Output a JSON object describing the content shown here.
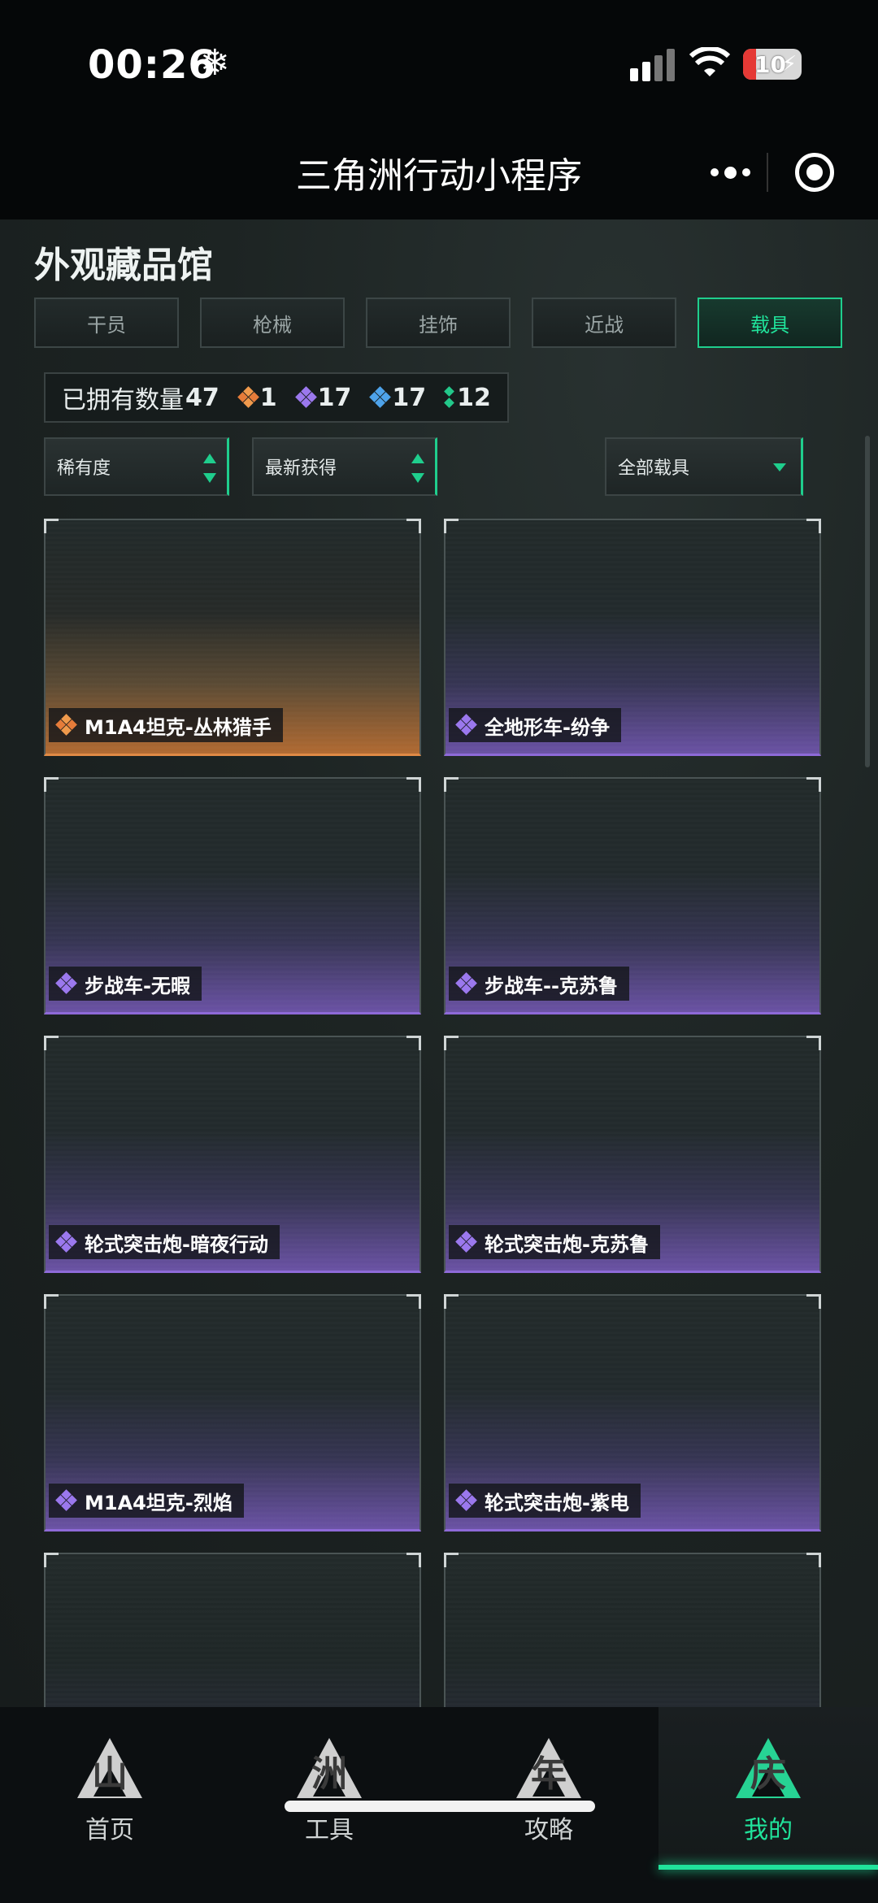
{
  "status_bar": {
    "time": "00:26",
    "battery": "10"
  },
  "title_bar": {
    "title": "三角洲行动小程序"
  },
  "page": {
    "title": "外观藏品馆",
    "tabs": [
      {
        "label": "干员",
        "active": false
      },
      {
        "label": "枪械",
        "active": false
      },
      {
        "label": "挂饰",
        "active": false
      },
      {
        "label": "近战",
        "active": false
      },
      {
        "label": "载具",
        "active": true
      }
    ],
    "owned": {
      "label": "已拥有数量",
      "total": "47",
      "counts": [
        {
          "icon": "orange-rarity-icon",
          "value": "1"
        },
        {
          "icon": "purple-rarity-icon",
          "value": "17"
        },
        {
          "icon": "blue-rarity-icon",
          "value": "17"
        },
        {
          "icon": "green-rarity-icon",
          "value": "12"
        }
      ]
    },
    "filters": {
      "rarity": "稀有度",
      "recent": "最新获得",
      "category": "全部载具"
    },
    "items": [
      {
        "name": "M1A4坦克-丛林猎手",
        "rarity": "orange"
      },
      {
        "name": "全地形车-纷争",
        "rarity": "purple"
      },
      {
        "name": "步战车-无暇",
        "rarity": "purple"
      },
      {
        "name": "步战车--克苏鲁",
        "rarity": "purple"
      },
      {
        "name": "轮式突击炮-暗夜行动",
        "rarity": "purple"
      },
      {
        "name": "轮式突击炮-克苏鲁",
        "rarity": "purple"
      },
      {
        "name": "M1A4坦克-烈焰",
        "rarity": "purple"
      },
      {
        "name": "轮式突击炮-紫电",
        "rarity": "purple"
      },
      {
        "name": "",
        "rarity": "none"
      },
      {
        "name": "",
        "rarity": "none"
      }
    ]
  },
  "bottom_nav": [
    {
      "label": "首页",
      "glyph": "山",
      "active": false
    },
    {
      "label": "工具",
      "glyph": "洲",
      "active": false
    },
    {
      "label": "攻略",
      "glyph": "年",
      "active": false
    },
    {
      "label": "我的",
      "glyph": "庆",
      "active": true
    }
  ],
  "colors": {
    "accent": "#20e39b",
    "purple": "#8e6ad8",
    "orange": "#e08a45"
  }
}
